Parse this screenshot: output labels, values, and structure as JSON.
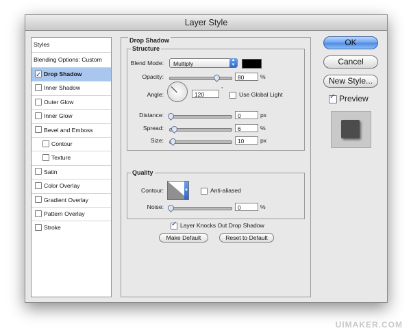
{
  "window": {
    "title": "Layer Style"
  },
  "styles_list": {
    "header": "Styles",
    "blending_options": "Blending Options: Custom",
    "items": [
      {
        "label": "Drop Shadow",
        "checked": true,
        "selected": true,
        "indent": false
      },
      {
        "label": "Inner Shadow",
        "checked": false,
        "selected": false,
        "indent": false
      },
      {
        "label": "Outer Glow",
        "checked": false,
        "selected": false,
        "indent": false
      },
      {
        "label": "Inner Glow",
        "checked": false,
        "selected": false,
        "indent": false
      },
      {
        "label": "Bevel and Emboss",
        "checked": false,
        "selected": false,
        "indent": false
      },
      {
        "label": "Contour",
        "checked": false,
        "selected": false,
        "indent": true
      },
      {
        "label": "Texture",
        "checked": false,
        "selected": false,
        "indent": true
      },
      {
        "label": "Satin",
        "checked": false,
        "selected": false,
        "indent": false
      },
      {
        "label": "Color Overlay",
        "checked": false,
        "selected": false,
        "indent": false
      },
      {
        "label": "Gradient Overlay",
        "checked": false,
        "selected": false,
        "indent": false
      },
      {
        "label": "Pattern Overlay",
        "checked": false,
        "selected": false,
        "indent": false
      },
      {
        "label": "Stroke",
        "checked": false,
        "selected": false,
        "indent": false
      }
    ]
  },
  "drop_shadow": {
    "title": "Drop Shadow",
    "structure": {
      "title": "Structure",
      "blend_mode_label": "Blend Mode:",
      "blend_mode_value": "Multiply",
      "shadow_color": "#000000",
      "opacity_label": "Opacity:",
      "opacity_value": "80",
      "opacity_unit": "%",
      "opacity_level": 0.8,
      "angle_label": "Angle:",
      "angle_value": "120",
      "angle_unit": "°",
      "use_global_light_label": "Use Global Light",
      "use_global_light_checked": false,
      "distance_label": "Distance:",
      "distance_value": "0",
      "distance_unit": "px",
      "distance_level": 0.0,
      "spread_label": "Spread:",
      "spread_value": "6",
      "spread_unit": "%",
      "spread_level": 0.06,
      "size_label": "Size:",
      "size_value": "10",
      "size_unit": "px",
      "size_level": 0.04
    },
    "quality": {
      "title": "Quality",
      "contour_label": "Contour:",
      "anti_aliased_label": "Anti-aliased",
      "anti_aliased_checked": false,
      "noise_label": "Noise:",
      "noise_value": "0",
      "noise_unit": "%",
      "noise_level": 0.0
    },
    "knockout_label": "Layer Knocks Out Drop Shadow",
    "knockout_checked": true,
    "make_default_label": "Make Default",
    "reset_default_label": "Reset to Default"
  },
  "buttons": {
    "ok": "OK",
    "cancel": "Cancel",
    "new_style": "New Style...",
    "preview_label": "Preview",
    "preview_checked": true
  },
  "watermark": "UIMAKER.COM"
}
